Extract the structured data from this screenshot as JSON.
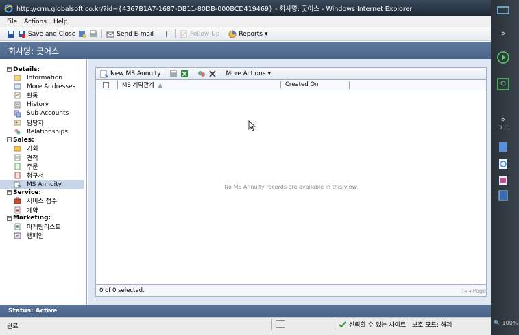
{
  "window": {
    "title": "http://crm.globalsoft.co.kr/?id={4367B1A7-1687-DB11-80DB-000BCD419469} - 회사명: 굿어스 - Windows Internet Explorer"
  },
  "menu": {
    "file": "File",
    "actions": "Actions",
    "help": "Help"
  },
  "toolbar": {
    "save_close": "Save and Close",
    "send_email": "Send E-mail",
    "follow_up": "Follow Up",
    "reports": "Reports"
  },
  "record": {
    "header": "회사명: 굿어스"
  },
  "nav": {
    "details": {
      "label": "Details:",
      "items": [
        "Information",
        "More Addresses",
        "활동",
        "History",
        "Sub-Accounts",
        "담당자",
        "Relationships"
      ]
    },
    "sales": {
      "label": "Sales:",
      "items": [
        "기회",
        "견적",
        "주문",
        "청구서",
        "MS Annuity"
      ]
    },
    "service": {
      "label": "Service:",
      "items": [
        "서비스 접수",
        "계약"
      ]
    },
    "marketing": {
      "label": "Marketing:",
      "items": [
        "마케팅리스트",
        "캠페인"
      ]
    },
    "selected": "MS Annuity"
  },
  "grid": {
    "new_button": "New MS Annuity",
    "more_actions": "More Actions",
    "columns": [
      "MS 계약관계",
      "Created On"
    ],
    "empty_message": "No MS Annuity records are available in this view.",
    "selection_text": "0 of 0 selected.",
    "pager_text": "Page"
  },
  "status": {
    "label": "Status: Active"
  },
  "iestatus": {
    "done": "완료",
    "zone": "신뢰할 수 있는 사이트 | 보호 모드: 해제",
    "zoom": "100%"
  },
  "icons": {
    "trusted_check_color": "#2e9a2e",
    "accent": "#4a6489"
  }
}
